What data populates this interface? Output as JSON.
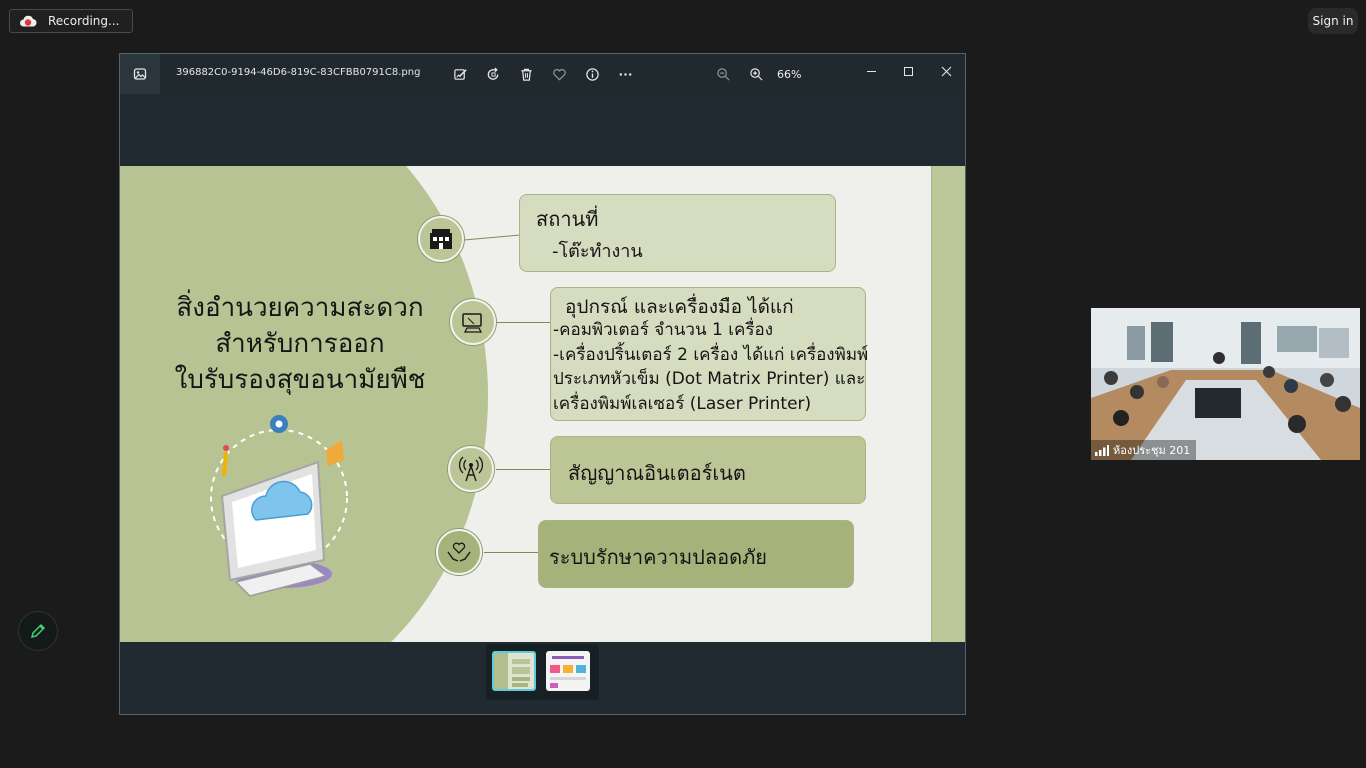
{
  "recording": {
    "label": "Recording..."
  },
  "account": {
    "signin_label": "Sign in"
  },
  "viewer": {
    "filename": "396882C0-9194-46D6-819C-83CFBB0791C8.png",
    "zoom_level": "66%",
    "toolbar_icons": [
      "edit-image-icon",
      "rotate-icon",
      "delete-icon",
      "favorite-icon",
      "info-icon",
      "more-icon",
      "zoom-out-icon",
      "zoom-in-icon"
    ],
    "window_controls": [
      "minimize-icon",
      "maximize-icon",
      "close-icon"
    ],
    "thumbnail_count": 2
  },
  "slide": {
    "title_lines": [
      "สิ่งอำนวยความสะดวก",
      "สำหรับการออก",
      "ใบรับรองสุขอนามัยพืช"
    ],
    "card1": {
      "head": "สถานที่",
      "line1": "-โต๊ะทำงาน"
    },
    "card2": {
      "head": "อุปกรณ์ และเครื่องมือ ได้แก่",
      "line1": "-คอมพิวเตอร์ จำนวน 1 เครื่อง",
      "line2": "-เครื่องปริ้นเตอร์ 2 เครื่อง ได้แก่ เครื่องพิมพ์",
      "line3": "ประเภทหัวเข็ม (Dot Matrix Printer) และ",
      "line4": "เครื่องพิมพ์เลเซอร์ (Laser Printer)"
    },
    "card3": {
      "head": "สัญญาณอินเตอร์เนต"
    },
    "card4": {
      "head": "ระบบรักษาความปลอดภัย"
    },
    "colors": {
      "green_dark": "#a5b27a",
      "green_light": "#d6dcbf",
      "circle": "#b8c393"
    }
  },
  "camera": {
    "room_label": "ห้องประชุม 201"
  },
  "colors": {
    "accent": "#5fc9dd",
    "background": "#1b1b1b"
  }
}
